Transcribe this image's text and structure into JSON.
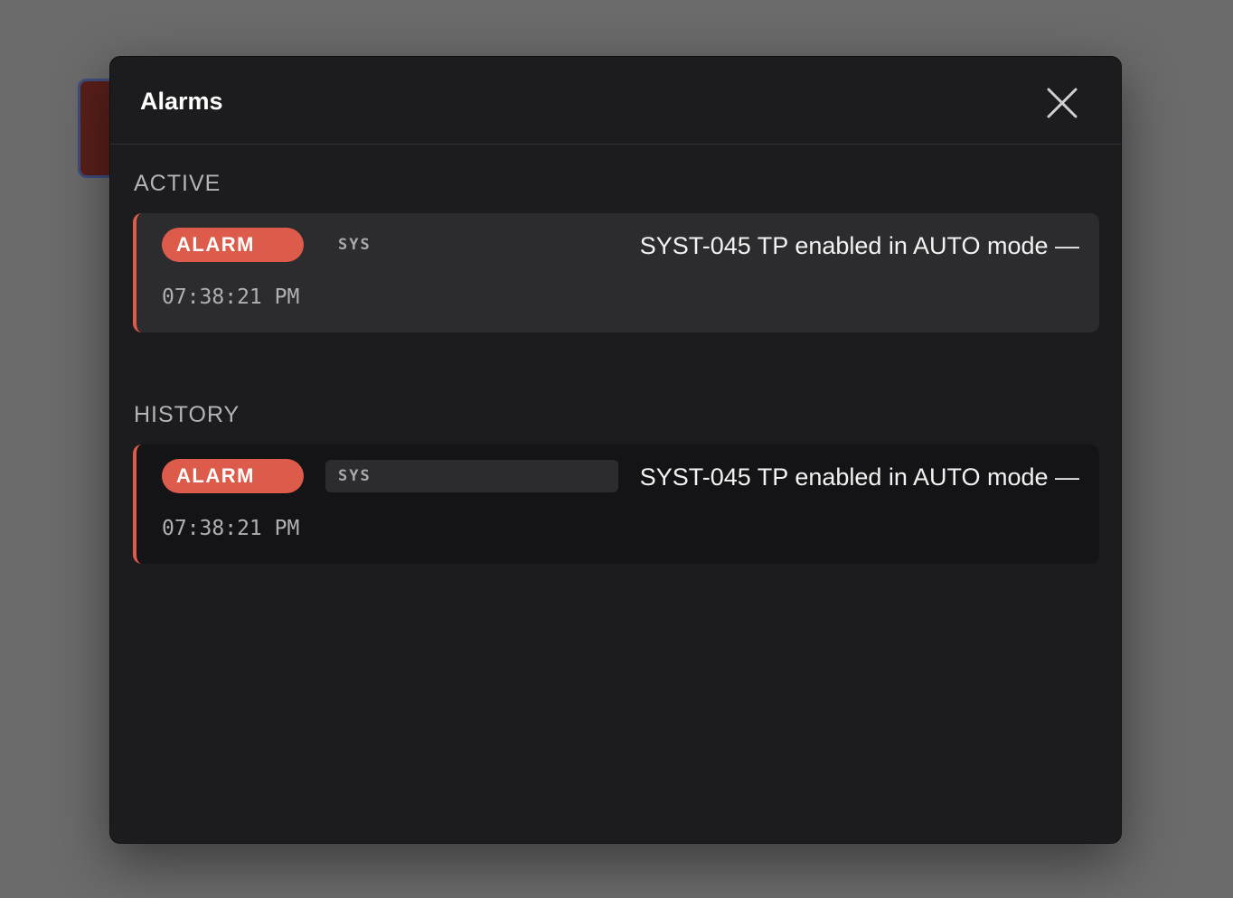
{
  "modal": {
    "title": "Alarms",
    "close_icon": "close-icon"
  },
  "active": {
    "heading": "ACTIVE",
    "items": [
      {
        "severity": "ALARM",
        "source": "SYS",
        "message": "SYST-045 TP enabled in AUTO mode —",
        "time": "07:38:21 PM"
      }
    ]
  },
  "history": {
    "heading": "HISTORY",
    "items": [
      {
        "severity": "ALARM",
        "source": "SYS",
        "message": "SYST-045 TP enabled in AUTO mode —",
        "time": "07:38:21 PM"
      }
    ]
  },
  "colors": {
    "alarm_accent": "#dd5b4b",
    "modal_bg": "#1c1c1e",
    "overlay_bg": "#6b6b6b"
  }
}
